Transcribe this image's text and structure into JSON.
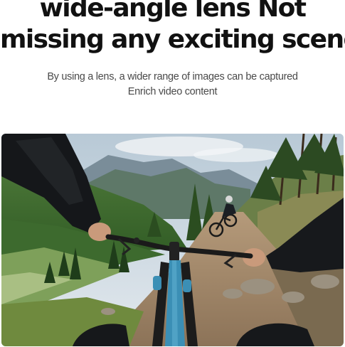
{
  "headline": {
    "line1": "wide-angle lens Not",
    "line2": "missing any exciting scenes"
  },
  "subtitle": {
    "line1": "By using a lens, a wider range of images can be captured",
    "line2": "Enrich video content"
  },
  "colors": {
    "headline": "#111111",
    "subtitle": "#4a4a4a",
    "bike_frame": "#3b8fb5"
  }
}
